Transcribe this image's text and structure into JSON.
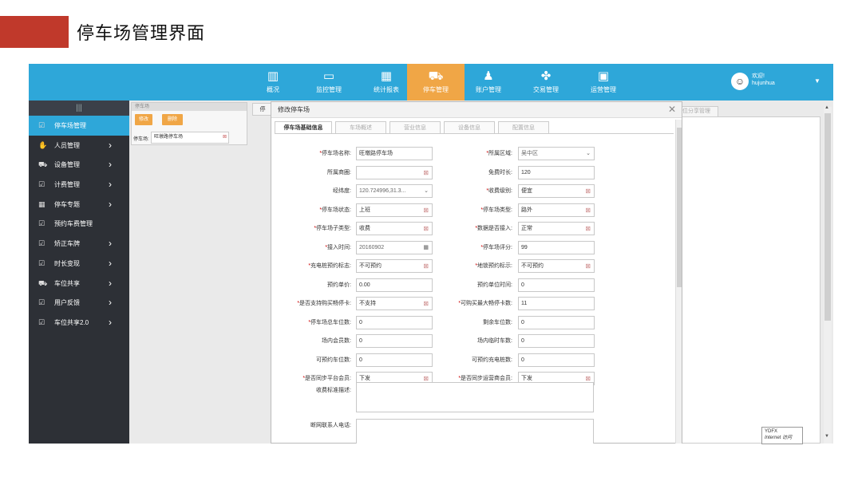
{
  "slide": {
    "title": "停车场管理界面"
  },
  "nav": [
    {
      "label": "概况",
      "icon": "bar-chart-icon",
      "glyph": "▥"
    },
    {
      "label": "监控管理",
      "icon": "monitor-icon",
      "glyph": "▭"
    },
    {
      "label": "统计报表",
      "icon": "calendar-icon",
      "glyph": "▦"
    },
    {
      "label": "停车管理",
      "icon": "car-icon",
      "glyph": "⛟"
    },
    {
      "label": "账户管理",
      "icon": "person-icon",
      "glyph": "♟"
    },
    {
      "label": "交易管理",
      "icon": "handshake-icon",
      "glyph": "✤"
    },
    {
      "label": "运营管理",
      "icon": "document-icon",
      "glyph": "▣"
    }
  ],
  "user": {
    "greeting": "欢迎!",
    "name": "hujunhua",
    "avatar_glyph": "☺",
    "dropdown_glyph": "▼"
  },
  "sidebar": {
    "handle": "|||",
    "items": [
      {
        "label": "停车场管理",
        "icon": "edit-icon",
        "glyph": "☑",
        "chevron": ""
      },
      {
        "label": "人员管理",
        "icon": "hand-icon",
        "glyph": "✋",
        "chevron": "›"
      },
      {
        "label": "设备管理",
        "icon": "car-icon",
        "glyph": "⛟",
        "chevron": "›"
      },
      {
        "label": "计费管理",
        "icon": "edit-icon",
        "glyph": "☑",
        "chevron": "›"
      },
      {
        "label": "停车专题",
        "icon": "grid-icon",
        "glyph": "▦",
        "chevron": "›"
      },
      {
        "label": "预约车费管理",
        "icon": "edit-icon",
        "glyph": "☑",
        "chevron": ""
      },
      {
        "label": "矫正车牌",
        "icon": "edit-icon",
        "glyph": "☑",
        "chevron": "›"
      },
      {
        "label": "时长变现",
        "icon": "edit-icon",
        "glyph": "☑",
        "chevron": "›"
      },
      {
        "label": "车位共享",
        "icon": "car-icon",
        "glyph": "⛟",
        "chevron": "›"
      },
      {
        "label": "用户反馈",
        "icon": "edit-icon",
        "glyph": "☑",
        "chevron": "›"
      },
      {
        "label": "车位共享2.0",
        "icon": "edit-icon",
        "glyph": "☑",
        "chevron": "›"
      }
    ]
  },
  "parking_tab": {
    "header": "停车场",
    "modify_btn": "修改",
    "delete_btn": "删除",
    "field_label": "停车场:",
    "field_value": "旺墩路停车场",
    "clear_glyph": "⊠"
  },
  "tab_back_label": "停",
  "tab_right_label": "位分享管理",
  "modal": {
    "title": "修改停车场",
    "close": "✕",
    "tabs": [
      "停车场基础信息",
      "车场概述",
      "营业信息",
      "设备信息",
      "配置信息"
    ],
    "left_fields": [
      {
        "label": "停车场名称:",
        "req": "*",
        "value": "旺墩路停车场",
        "kind": "text"
      },
      {
        "label": "所属商圈:",
        "req": "",
        "value": "",
        "kind": "clear"
      },
      {
        "label": "经纬度:",
        "req": "",
        "value": "120.724996,31.3...",
        "kind": "select"
      },
      {
        "label": "停车场状态:",
        "req": "*",
        "value": "上班",
        "kind": "clear"
      },
      {
        "label": "停车场子类型:",
        "req": "*",
        "value": "收费",
        "kind": "clear"
      },
      {
        "label": "接入时间:",
        "req": "*",
        "value": "20160902",
        "kind": "date"
      },
      {
        "label": "充电桩预约标志:",
        "req": "*",
        "value": "不可预约",
        "kind": "clear"
      },
      {
        "label": "预约单价:",
        "req": "",
        "value": "0.00",
        "kind": "text"
      },
      {
        "label": "是否支持购买畅停卡:",
        "req": "*",
        "value": "不支持",
        "kind": "clear"
      },
      {
        "label": "停车场总车位数:",
        "req": "*",
        "value": "0",
        "kind": "text"
      },
      {
        "label": "场内会员数:",
        "req": "",
        "value": "0",
        "kind": "text"
      },
      {
        "label": "可预约车位数:",
        "req": "",
        "value": "0",
        "kind": "text"
      },
      {
        "label": "是否同步平台会员:",
        "req": "*",
        "value": "下发",
        "kind": "clear"
      }
    ],
    "right_fields": [
      {
        "label": "所属区域:",
        "req": "*",
        "value": "吴中区",
        "kind": "select"
      },
      {
        "label": "免费时长:",
        "req": "",
        "value": "120",
        "kind": "text"
      },
      {
        "label": "收费级别:",
        "req": "*",
        "value": "便宜",
        "kind": "clear"
      },
      {
        "label": "停车场类型:",
        "req": "*",
        "value": "路外",
        "kind": "clear"
      },
      {
        "label": "数据是否接入:",
        "req": "*",
        "value": "正常",
        "kind": "clear"
      },
      {
        "label": "停车场评分:",
        "req": "*",
        "value": "99",
        "kind": "text"
      },
      {
        "label": "地锁预约标示:",
        "req": "*",
        "value": "不可预约",
        "kind": "clear"
      },
      {
        "label": "预约单位时间:",
        "req": "",
        "value": "0",
        "kind": "text"
      },
      {
        "label": "可购买最大畅停卡数:",
        "req": "*",
        "value": "11",
        "kind": "text"
      },
      {
        "label": "剩余车位数:",
        "req": "",
        "value": "0",
        "kind": "text"
      },
      {
        "label": "场内临时车数:",
        "req": "",
        "value": "0",
        "kind": "text"
      },
      {
        "label": "可预约充电桩数:",
        "req": "",
        "value": "0",
        "kind": "text"
      },
      {
        "label": "是否同步运营商会员:",
        "req": "*",
        "value": "下发",
        "kind": "clear"
      }
    ],
    "fee_desc_label": "收费标准描述:",
    "contact_label": "断网联系人电话:",
    "clear_glyph": "⊠",
    "select_glyph": "⌄",
    "date_glyph": "▦"
  },
  "tooltip": {
    "line1": "YDFX",
    "line2": "Internet 访问"
  }
}
